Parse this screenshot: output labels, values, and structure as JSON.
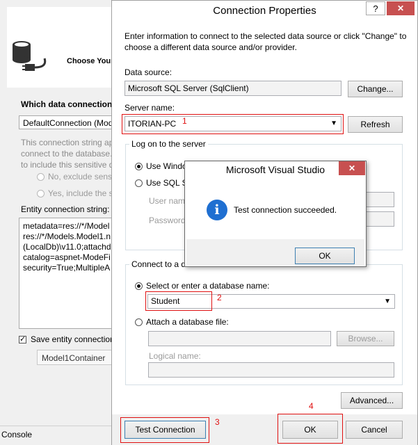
{
  "wizard": {
    "title": "Choose Your",
    "question": "Which data connection s",
    "connection_value": "DefaultConnection (Mod",
    "note_lines": [
      "This connection string ap",
      "connect to the database.",
      "to include this sensitive d"
    ],
    "radio_no": "No, exclude sensi",
    "radio_yes": "Yes, include the s",
    "ecs_label": "Entity connection string:",
    "ecs_lines": [
      "metadata=res://*/Model",
      "res://*/Models.Model1.n",
      "(LocalDb)\\v11.0;attachdb",
      "catalog=aspnet-ModeFi",
      "security=True;MultipleA"
    ],
    "save_label": "Save entity connection",
    "container_name": "Model1Container",
    "console_label": "Console"
  },
  "dialog": {
    "title": "Connection Properties",
    "help_glyph": "?",
    "close_glyph": "✕",
    "intro": "Enter information to connect to the selected data source or click \"Change\" to choose a different data source and/or provider.",
    "data_source_label": "Data source:",
    "data_source_value": "Microsoft SQL Server (SqlClient)",
    "change_button": "Change...",
    "server_name_label": "Server name:",
    "server_name_value": "ITORIAN-PC",
    "refresh_button": "Refresh",
    "logon_group": "Log on to the server",
    "windows_auth": "Use Windows Authentication",
    "sql_auth": "Use SQL Server Authentication",
    "user_name_label": "User name:",
    "password_label": "Password:",
    "connect_db_group": "Connect to a database",
    "select_db_option": "Select or enter a database name:",
    "database_value": "Student",
    "attach_option": "Attach a database file:",
    "browse_button": "Browse...",
    "logical_name_label": "Logical name:",
    "advanced_button": "Advanced...",
    "test_button": "Test Connection",
    "ok_button": "OK",
    "cancel_button": "Cancel"
  },
  "message_box": {
    "title": "Microsoft Visual Studio",
    "close_glyph": "✕",
    "icon_glyph": "i",
    "text": "Test connection succeeded.",
    "ok_button": "OK"
  },
  "annotations": {
    "n1": "1",
    "n2": "2",
    "n3": "3",
    "n4": "4"
  },
  "colors": {
    "annotation_red": "#e01010",
    "info_blue": "#1f6fd1",
    "close_red": "#c75050"
  }
}
